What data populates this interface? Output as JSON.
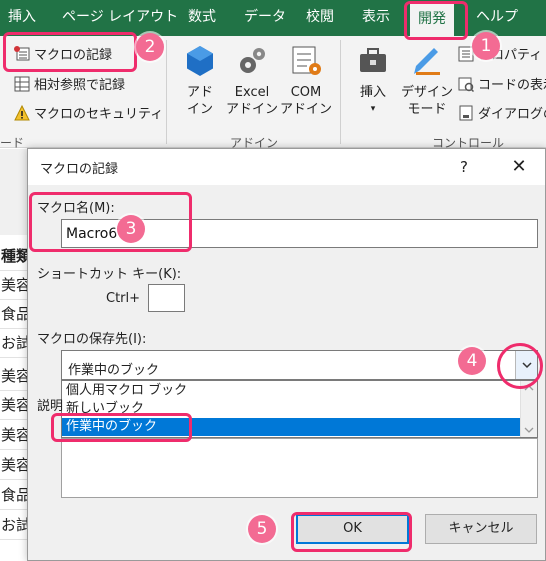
{
  "ribbon_tabs": {
    "insert": "挿入",
    "page_layout": "ページ レイアウト",
    "formulas": "数式",
    "data": "データ",
    "review": "校閲",
    "view": "表示",
    "developer": "開発",
    "help": "ヘルプ"
  },
  "ribbon": {
    "record_macro": "マクロの記録",
    "relative_ref": "相対参照で記録",
    "macro_security": "マクロのセキュリティ",
    "code_group": "ード",
    "addin_label_1": "アド",
    "addin_label_2": "イン",
    "excel_addin_1": "Excel",
    "excel_addin_2": "アドイン",
    "com_addin_1": "COM",
    "com_addin_2": "アドイン",
    "addin_group": "アドイン",
    "insert_label": "挿入",
    "design_mode_1": "デザイン",
    "design_mode_2": "モード",
    "properties": "プロパティ",
    "view_code": "コードの表示",
    "dialog_run": "ダイアログの",
    "controls_group": "コントロール"
  },
  "sheet": {
    "header": "種類",
    "rows": [
      "美容",
      "食品",
      "お試",
      "美容",
      "美容",
      "美容",
      "美容",
      "食品",
      "お試"
    ]
  },
  "dialog": {
    "title": "マクロの記録",
    "help": "?",
    "close": "✕",
    "macro_name_label": "マクロ名(M):",
    "macro_name_value": "Macro6",
    "shortcut_label": "ショートカット キー(K):",
    "ctrl_label": "Ctrl+",
    "store_label": "マクロの保存先(I):",
    "store_value": "作業中のブック",
    "options": [
      "個人用マクロ ブック",
      "新しいブック",
      "作業中のブック"
    ],
    "selected_option_index": 2,
    "description_label": "説明",
    "ok": "OK",
    "cancel": "キャンセル"
  },
  "annotations": {
    "steps": [
      "1",
      "2",
      "3",
      "4",
      "5"
    ],
    "color": "#ef2c6c"
  },
  "colors": {
    "excel_green": "#217346",
    "selection_blue": "#0078d7"
  }
}
